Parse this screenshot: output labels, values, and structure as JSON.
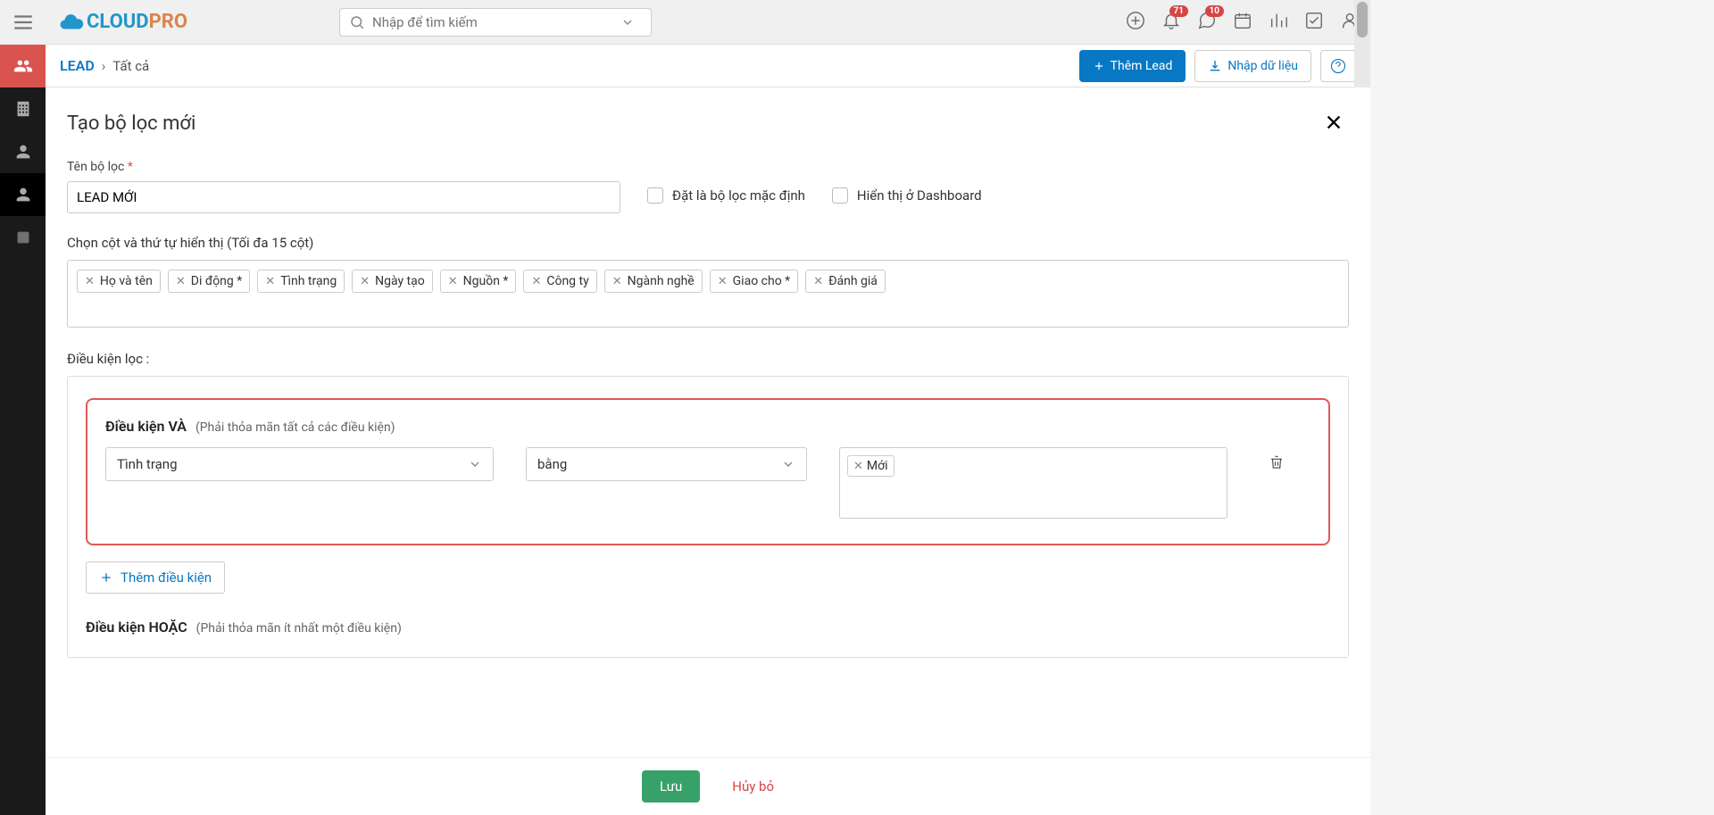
{
  "topbar": {
    "search_placeholder": "Nhập để tìm kiếm",
    "badge_bell": "71",
    "badge_chat": "10"
  },
  "subheader": {
    "lead": "LEAD",
    "crumb": "Tất cả",
    "add_lead": "Thêm Lead",
    "import": "Nhập dữ liệu"
  },
  "modal": {
    "title": "Tạo bộ lọc mới",
    "filter_name_label": "Tên bộ lọc",
    "filter_name_value": "LEAD MỚI",
    "default_checkbox": "Đặt là bộ lọc mặc định",
    "dashboard_checkbox": "Hiển thị ở Dashboard",
    "columns_label": "Chọn cột và thứ tự hiển thị (Tối đa 15 cột)",
    "columns": [
      "Họ và tên",
      "Di động *",
      "Tình trạng",
      "Ngày tạo",
      "Nguồn *",
      "Công ty",
      "Ngành nghề",
      "Giao cho *",
      "Đánh giá"
    ],
    "condition_label": "Điều kiện lọc :",
    "and_title": "Điều kiện VÀ",
    "and_subtitle": "(Phải thỏa mãn tất cả các điều kiện)",
    "cond_field": "Tình trạng",
    "cond_op": "bằng",
    "cond_value": "Mới",
    "add_condition": "Thêm điều kiện",
    "or_title": "Điều kiện HOẶC",
    "or_subtitle": "(Phải thỏa mãn ít nhất một điều kiện)",
    "save": "Lưu",
    "cancel": "Hủy bỏ"
  }
}
